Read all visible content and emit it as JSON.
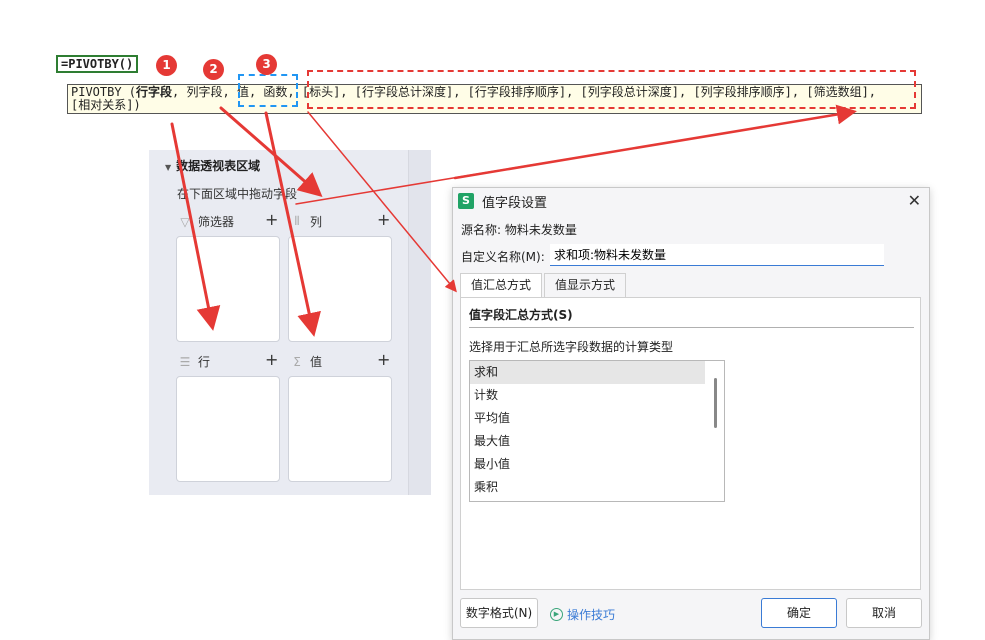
{
  "formula": {
    "text": "=PIVOTBY()"
  },
  "tooltip": {
    "line1_prefix": "PIVOTBY (",
    "line1_bold": "行字段",
    "line1_rest": ", 列字段, 值, 函数, [标头], [行字段总计深度], [行字段排序顺序], [列字段总计深度], [列字段排序顺序], [筛选数组],",
    "line2": "[相对关系])"
  },
  "badges": [
    "1",
    "2",
    "3"
  ],
  "pivot_panel": {
    "title": "数据透视表区域",
    "subtitle": "在下面区域中拖动字段",
    "areas": [
      {
        "label": "筛选器",
        "icon": "filter-icon"
      },
      {
        "label": "列",
        "icon": "columns-icon"
      },
      {
        "label": "行",
        "icon": "rows-icon"
      },
      {
        "label": "值",
        "icon": "sigma-icon"
      }
    ]
  },
  "dialog": {
    "title": "值字段设置",
    "app_icon": "S",
    "source_label": "源名称: 物料未发数量",
    "custom_name_label": "自定义名称(M):",
    "custom_name_value": "求和项:物料未发数量",
    "tabs": [
      "值汇总方式",
      "值显示方式"
    ],
    "section_title": "值字段汇总方式(S)",
    "section_desc": "选择用于汇总所选字段数据的计算类型",
    "functions": [
      "求和",
      "计数",
      "平均值",
      "最大值",
      "最小值",
      "乘积"
    ],
    "selected_function": "求和",
    "number_format_button": "数字格式(N)",
    "tips_link": "操作技巧",
    "ok_button": "确定",
    "cancel_button": "取消"
  },
  "colors": {
    "annotation_red": "#e53935",
    "annotation_blue": "#2196f3",
    "accent": "#3a7bd5"
  }
}
